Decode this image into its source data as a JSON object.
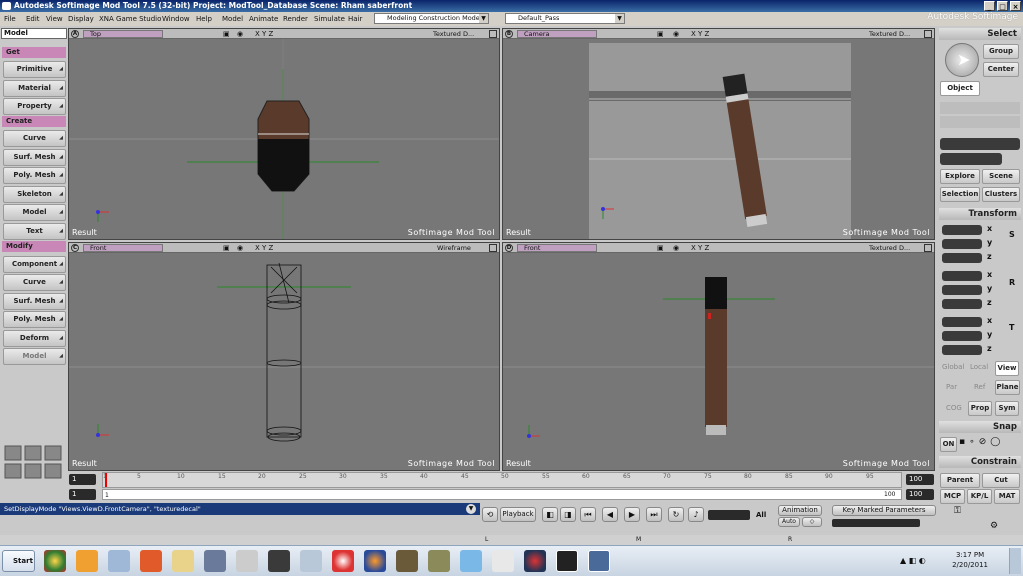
{
  "window": {
    "title": "Autodesk Softimage Mod Tool 7.5 (32-bit)     Project: ModTool_Database     Scene: Rham saberfront",
    "controls": [
      "_",
      "□",
      "×"
    ]
  },
  "menu": {
    "items": [
      "File",
      "Edit",
      "View",
      "Display",
      "XNA Game Studio",
      "Window",
      "Help",
      "Model",
      "Animate",
      "Render",
      "Simulate",
      "Hair"
    ],
    "mode": "Modeling Construction Mode",
    "pass": "Default_Pass",
    "brand": "Autodesk Softimage"
  },
  "left": {
    "model": "Model",
    "sections": {
      "get": "Get",
      "create": "Create",
      "modify": "Modify"
    },
    "get_buttons": [
      "Primitive",
      "Material",
      "Property"
    ],
    "create_buttons": [
      "Curve",
      "Surf. Mesh",
      "Poly. Mesh",
      "Skeleton",
      "Model",
      "Text"
    ],
    "modify_buttons": [
      "Component",
      "Curve",
      "Surf. Mesh",
      "Poly. Mesh",
      "Deform",
      "Model"
    ]
  },
  "viewports": [
    {
      "letter": "A",
      "camera": "Top",
      "mode": "Textured D...",
      "result": "Result",
      "tool": "Softimage Mod Tool"
    },
    {
      "letter": "B",
      "camera": "Camera",
      "mode": "Textured D...",
      "result": "Result",
      "tool": "Softimage Mod Tool"
    },
    {
      "letter": "C",
      "camera": "Front",
      "mode": "Wireframe",
      "result": "Result",
      "tool": "Softimage Mod Tool"
    },
    {
      "letter": "D",
      "camera": "Front",
      "mode": "Textured D...",
      "result": "Result",
      "tool": "Softimage Mod Tool"
    }
  ],
  "viewport_icons": {
    "axes": "X Y Z",
    "colors": {
      "bg": "#7a7a7a",
      "grid": "#8a8a8a",
      "axis_green": "#2a8a2a",
      "wood": "#5a3a2a"
    }
  },
  "right": {
    "select": "Select",
    "group": "Group",
    "center": "Center",
    "object": "Object",
    "explore": "Explore",
    "scene": "Scene",
    "selection": "Selection",
    "clusters": "Clusters",
    "transform": "Transform",
    "s": "S",
    "r": "R",
    "t": "T",
    "x": "x",
    "y": "y",
    "z": "z",
    "global": "Global",
    "local": "Local",
    "view": "View",
    "par": "Par",
    "ref": "Ref",
    "plane": "Plane",
    "cog": "COG",
    "prop": "Prop",
    "sym": "Sym",
    "snap": "Snap",
    "on": "ON",
    "constrain": "Constrain",
    "parent": "Parent",
    "cut": "Cut",
    "mcp": "MCP",
    "kpl": "KP/L",
    "mat": "MAT"
  },
  "timeline": {
    "start": "1",
    "end": "100",
    "current": "1",
    "ticks": [
      "1",
      "5",
      "10",
      "15",
      "20",
      "25",
      "30",
      "35",
      "40",
      "45",
      "50",
      "55",
      "60",
      "65",
      "70",
      "75",
      "80",
      "85",
      "90",
      "95"
    ],
    "all": "All",
    "end2": "100",
    "end3": "100"
  },
  "command": {
    "text": "SetDisplayMode \"Views.ViewD.FrontCamera\", \"texturedecal\""
  },
  "play": {
    "playback": "Playback",
    "animation": "Animation",
    "auto": "Auto",
    "key_marked": "Key Marked Parameters"
  },
  "status": {
    "l": "L",
    "m": "M",
    "r": "R"
  },
  "taskbar": {
    "start": "Start",
    "time": "3:17 PM",
    "date": "2/20/2011"
  }
}
